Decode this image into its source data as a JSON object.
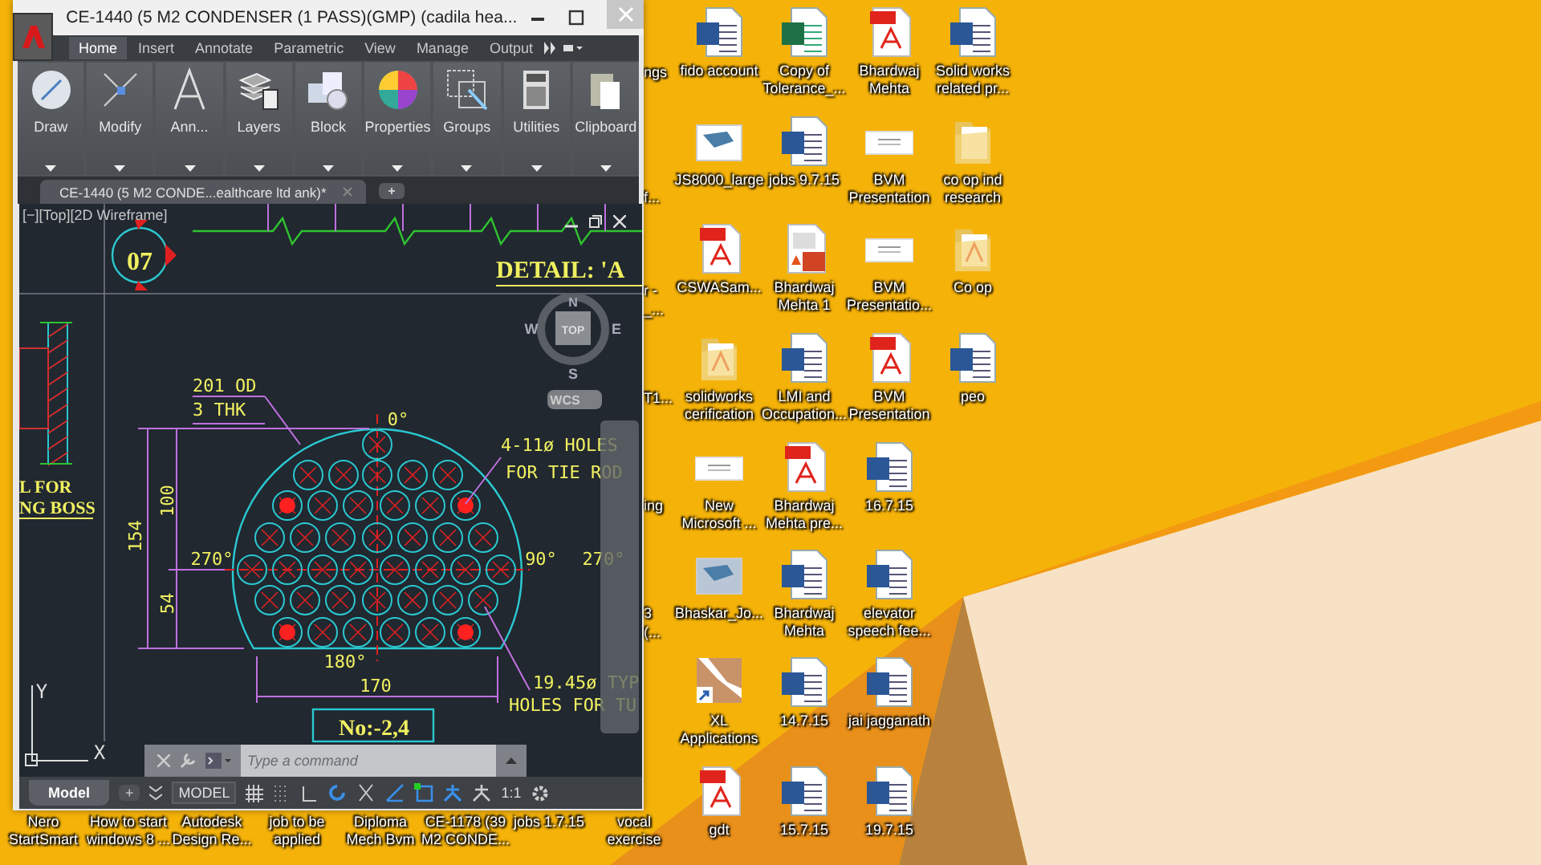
{
  "cad_window": {
    "title": "CE-1440 (5 M2 CONDENSER (1 PASS)(GMP) (cadila hea...",
    "ribbon_tabs": [
      {
        "label": "Home",
        "selected": true
      },
      {
        "label": "Insert",
        "selected": false
      },
      {
        "label": "Annotate",
        "selected": false
      },
      {
        "label": "Parametric",
        "selected": false
      },
      {
        "label": "View",
        "selected": false
      },
      {
        "label": "Manage",
        "selected": false
      },
      {
        "label": "Output",
        "selected": false
      }
    ],
    "ribbon_panels": [
      {
        "label": "Draw",
        "kind": "draw"
      },
      {
        "label": "Modify",
        "kind": "modify"
      },
      {
        "label": "Ann...",
        "kind": "annotation"
      },
      {
        "label": "Layers",
        "kind": "layers"
      },
      {
        "label": "Block",
        "kind": "block"
      },
      {
        "label": "Properties",
        "kind": "properties"
      },
      {
        "label": "Groups",
        "kind": "groups"
      },
      {
        "label": "Utilities",
        "kind": "utilities"
      },
      {
        "label": "Clipboard",
        "kind": "clipboard"
      }
    ],
    "document_tab": "CE-1440 (5 M2 CONDE...ealthcare ltd ank)*",
    "viewport_label": "[−][Top][2D Wireframe]",
    "drawing_labels": [
      "07",
      "DETAIL: 'A",
      "201 OD",
      "3 THK",
      "0°",
      "4-11ø HOLES",
      "FOR TIE ROD",
      "L FOR",
      "NG BOSS",
      "100",
      "154",
      "54",
      "270°",
      "90°",
      "270°",
      "180°",
      "170",
      "19.45ø TYP",
      "HOLES FOR TU",
      "No:-2,4",
      "Y",
      "X"
    ],
    "view_cube": {
      "top": "TOP",
      "north": "N",
      "west": "W",
      "east": "E",
      "south": "S",
      "ucs": "WCS"
    },
    "command_line": {
      "placeholder": "Type a command"
    },
    "layout_tabs": [
      {
        "label": "Model",
        "selected": true
      }
    ],
    "add_tab": "+",
    "status_bar": {
      "mode": "MODEL",
      "scale": "1:1"
    }
  },
  "desktop_icons": [
    {
      "label": "fido account",
      "kind": "word"
    },
    {
      "label": "JS8000_large",
      "kind": "image"
    },
    {
      "label": "CSWASam...",
      "kind": "pdf"
    },
    {
      "label": "solidworks cerification",
      "kind": "folder-pdf"
    },
    {
      "label": "New Microsoft ...",
      "kind": "doc"
    },
    {
      "label": "Bhaskar_Jo...",
      "kind": "image"
    },
    {
      "label": "XL Applications",
      "kind": "shortcut"
    },
    {
      "label": "gdt",
      "kind": "pdf"
    },
    {
      "label": "Copy of Tolerance_...",
      "kind": "excel"
    },
    {
      "label": "jobs 9.7.15",
      "kind": "word"
    },
    {
      "label": "Bhardwaj Mehta 1",
      "kind": "ppt"
    },
    {
      "label": "LMI and Occupation...",
      "kind": "word"
    },
    {
      "label": "Bhardwaj Mehta pre...",
      "kind": "pdf"
    },
    {
      "label": "Bhardwaj Mehta",
      "kind": "word"
    },
    {
      "label": "14.7.15",
      "kind": "word"
    },
    {
      "label": "15.7.15",
      "kind": "word"
    },
    {
      "label": "Bhardwaj Mehta",
      "kind": "pdf"
    },
    {
      "label": "BVM Presentation",
      "kind": "doc"
    },
    {
      "label": "BVM Presentatio...",
      "kind": "doc"
    },
    {
      "label": "BVM Presentation",
      "kind": "pdf"
    },
    {
      "label": "16.7.15",
      "kind": "word"
    },
    {
      "label": "elevator speech fee...",
      "kind": "word"
    },
    {
      "label": "jai jagganath",
      "kind": "word"
    },
    {
      "label": "19.7.15",
      "kind": "word"
    },
    {
      "label": "Solid works related pr...",
      "kind": "word"
    },
    {
      "label": "co op ind research",
      "kind": "folder"
    },
    {
      "label": "Co op",
      "kind": "folder-pdf"
    },
    {
      "label": "peo",
      "kind": "word"
    }
  ],
  "covered_icon_labels": [
    "ngs",
    "f...",
    "r -",
    "_...",
    "T1...",
    "ing",
    "3",
    "(..."
  ],
  "bottom_icon_labels": [
    "Nero StartSmart",
    "How to start windows 8 ...",
    "Autodesk Design Re...",
    "job to be applied",
    "Diploma Mech Bvm",
    "CE-1178 (39 M2 CONDE...",
    "jobs 1.7.15",
    "vocal exercise"
  ]
}
